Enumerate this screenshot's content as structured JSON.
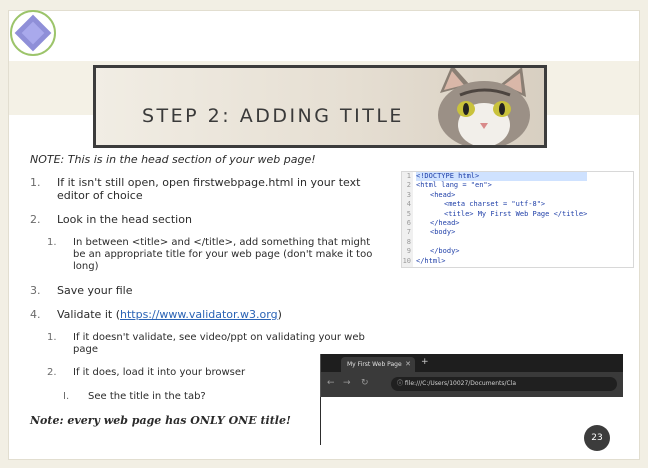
{
  "title": "STEP 2: ADDING TITLE",
  "note": "NOTE: This is in the head section of your web page!",
  "steps": [
    {
      "num": "1.",
      "text": "If it isn't still open, open firstwebpage.html in your text editor of choice"
    },
    {
      "num": "2.",
      "text": "Look in the head section"
    },
    {
      "num": "1.",
      "text": "In between <title> and </title>, add something that might be an appropriate title for your web page (don't make it too long)"
    },
    {
      "num": "3.",
      "text": "Save your file"
    },
    {
      "num": "4.",
      "text_before": "Validate it (",
      "link": "https://www.validator.w3.org",
      "text_after": ")"
    },
    {
      "num": "1.",
      "text": "If it doesn't validate, see video/ppt on validating your web page"
    },
    {
      "num": "2.",
      "text": "If it does, load it into your browser"
    },
    {
      "num": "I.",
      "text": "See the title in the tab?"
    }
  ],
  "final_note": "Note: every web page has ONLY ONE title!",
  "code": {
    "line_numbers": [
      "1",
      "2",
      "3",
      "4",
      "5",
      "6",
      "7",
      "8",
      "9",
      "10"
    ],
    "lines": [
      "<!DOCTYPE html>",
      "<html lang = \"en\">",
      "<head>",
      "<meta charset = \"utf-8\">",
      "<title> My First Web Page </title>",
      "</head>",
      "<body>",
      "",
      "</body>",
      "</html>"
    ]
  },
  "browser": {
    "tab_title": "My First Web Page",
    "address": "file:///C:/Users/10027/Documents/Cla"
  },
  "page_number": "23",
  "colors": {
    "accent": "#3c3c3c",
    "link": "#2a63b5",
    "corner": "#8f8fd8"
  }
}
